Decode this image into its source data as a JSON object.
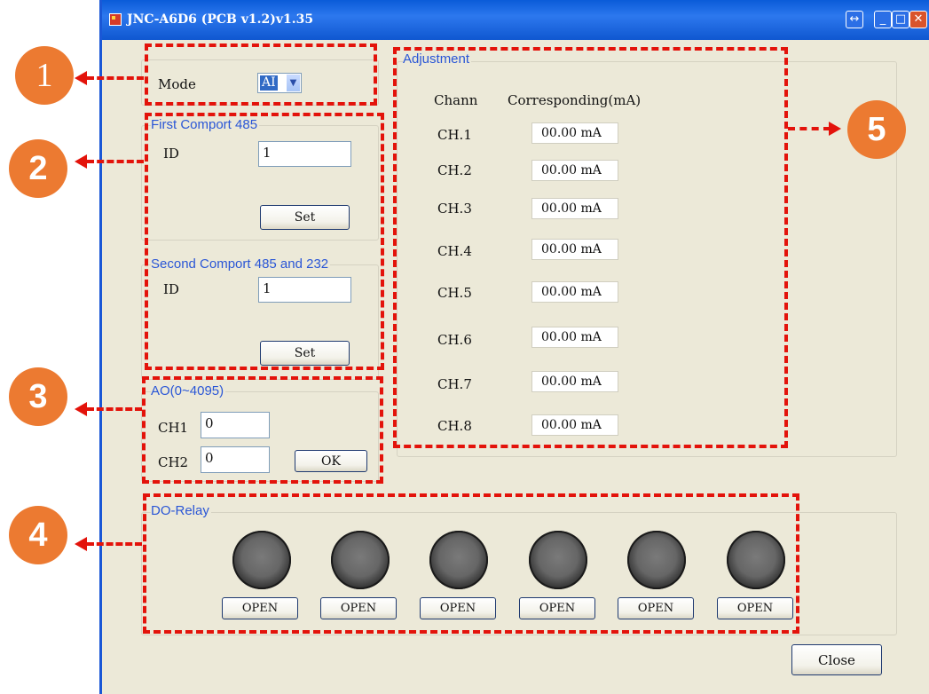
{
  "window": {
    "title": "JNC-A6D6 (PCB v1.2)v1.35",
    "buttons": {
      "restore_symbol": "↔",
      "minimize_symbol": "_",
      "maximize_symbol": "□",
      "close_symbol": "✕"
    }
  },
  "mode": {
    "label": "Mode",
    "selected": "AI",
    "arrow": "▼"
  },
  "first_comport": {
    "title": "First Comport 485",
    "id_label": "ID",
    "id_value": "1",
    "set_label": "Set"
  },
  "second_comport": {
    "title": "Second Comport 485 and 232",
    "id_label": "ID",
    "id_value": "1",
    "set_label": "Set"
  },
  "ao": {
    "title": "AO(0~4095)",
    "ch1_label": "CH1",
    "ch1_value": "0",
    "ch2_label": "CH2",
    "ch2_value": "0",
    "ok_label": "OK"
  },
  "adjustment": {
    "title": "Adjustment",
    "col_channel": "Chann",
    "col_value": "Corresponding(mA)",
    "rows": [
      {
        "channel": "CH.1",
        "value": "00.00 mA"
      },
      {
        "channel": "CH.2",
        "value": "00.00 mA"
      },
      {
        "channel": "CH.3",
        "value": "00.00 mA"
      },
      {
        "channel": "CH.4",
        "value": "00.00 mA"
      },
      {
        "channel": "CH.5",
        "value": "00.00 mA"
      },
      {
        "channel": "CH.6",
        "value": "00.00 mA"
      },
      {
        "channel": "CH.7",
        "value": "00.00 mA"
      },
      {
        "channel": "CH.8",
        "value": "00.00 mA"
      }
    ]
  },
  "do_relay": {
    "title": "DO-Relay",
    "relays": [
      {
        "button": "OPEN"
      },
      {
        "button": "OPEN"
      },
      {
        "button": "OPEN"
      },
      {
        "button": "OPEN"
      },
      {
        "button": "OPEN"
      },
      {
        "button": "OPEN"
      }
    ]
  },
  "close_button": "Close",
  "callouts": [
    "1",
    "2",
    "3",
    "4",
    "5"
  ],
  "colors": {
    "annotation_red": "#e3130b",
    "callout_orange": "#ec7a31",
    "window_bg": "#ece9d8",
    "titlebar_blue": "#0a5bd8",
    "group_label_blue": "#2a56d6"
  }
}
